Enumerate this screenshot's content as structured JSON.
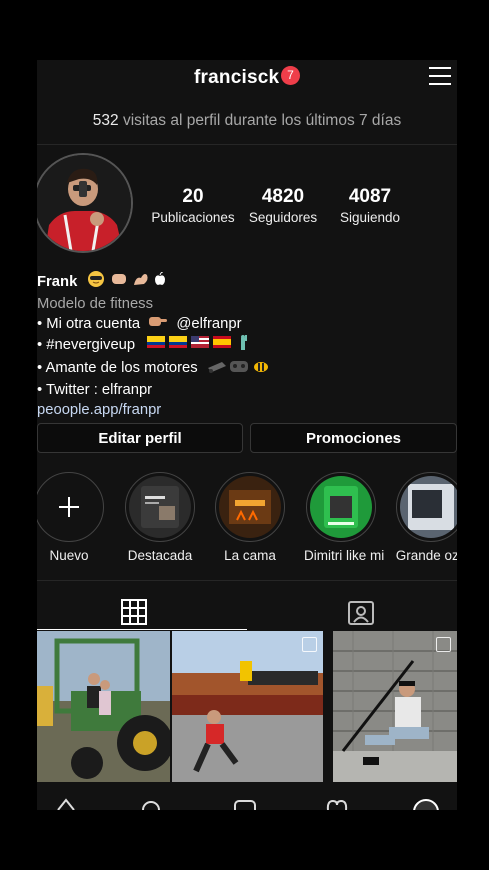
{
  "header": {
    "username": "francisck",
    "notification_count": "7"
  },
  "visits": {
    "count": "532",
    "text": "visitas al perfil durante los últimos 7 días"
  },
  "stats": [
    {
      "value": "20",
      "label": "Publicaciones"
    },
    {
      "value": "4820",
      "label": "Seguidores"
    },
    {
      "value": "4087",
      "label": "Siguiendo"
    }
  ],
  "bio": {
    "name": "Frank",
    "category": "Modelo de fitness",
    "line1": "• Mi otra cuenta",
    "line1_mention": "@elfranpr",
    "line2": "• #nevergiveup",
    "line3": "• Amante de los motores",
    "line4": "• Twitter : elfranpr",
    "link": "peoople.app/franpr"
  },
  "buttons": {
    "edit_profile": "Editar perfil",
    "promotions": "Promociones"
  },
  "highlights": [
    {
      "label": "Nuevo"
    },
    {
      "label": "Destacada"
    },
    {
      "label": "La cama"
    },
    {
      "label": "Dimitri like mi"
    },
    {
      "label": "Grande ozu"
    }
  ],
  "icons": {
    "menu": "hamburger-menu-icon",
    "grid_tab": "grid-icon",
    "tagged_tab": "tagged-person-icon",
    "new_highlight": "plus-icon"
  },
  "colors": {
    "background": "#121212",
    "notification": "#ef3e4a",
    "link": "#c7d8f2",
    "muted": "#a8a8a8"
  }
}
